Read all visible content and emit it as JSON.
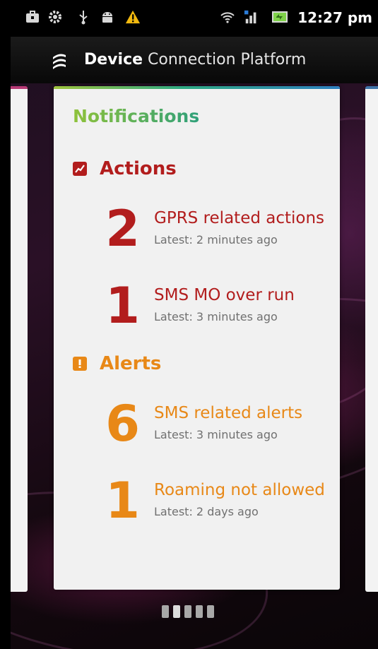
{
  "status_bar": {
    "time": "12:27 pm",
    "icons": [
      "briefcase-icon",
      "settings-icon",
      "usb-icon",
      "android-icon",
      "warning-icon",
      "wifi-icon",
      "signal-icon",
      "battery-icon"
    ]
  },
  "title_bar": {
    "title_bold": "Device",
    "title_rest": "Connection Platform"
  },
  "card": {
    "title": "Notifications",
    "actions": {
      "label": "Actions",
      "items": [
        {
          "count": "2",
          "title": "GPRS related actions",
          "latest": "Latest: 2 minutes ago"
        },
        {
          "count": "1",
          "title": "SMS MO over run",
          "latest": "Latest: 3 minutes ago"
        }
      ]
    },
    "alerts": {
      "label": "Alerts",
      "items": [
        {
          "count": "6",
          "title": "SMS related alerts",
          "latest": "Latest: 3 minutes ago"
        },
        {
          "count": "1",
          "title": "Roaming not allowed",
          "latest": "Latest: 2 days ago"
        }
      ]
    }
  },
  "colors": {
    "action": "#b21d1d",
    "alert": "#e88817",
    "notifications_green": "#5fb25a"
  },
  "pager": {
    "pages": 5,
    "active_index": 1
  }
}
